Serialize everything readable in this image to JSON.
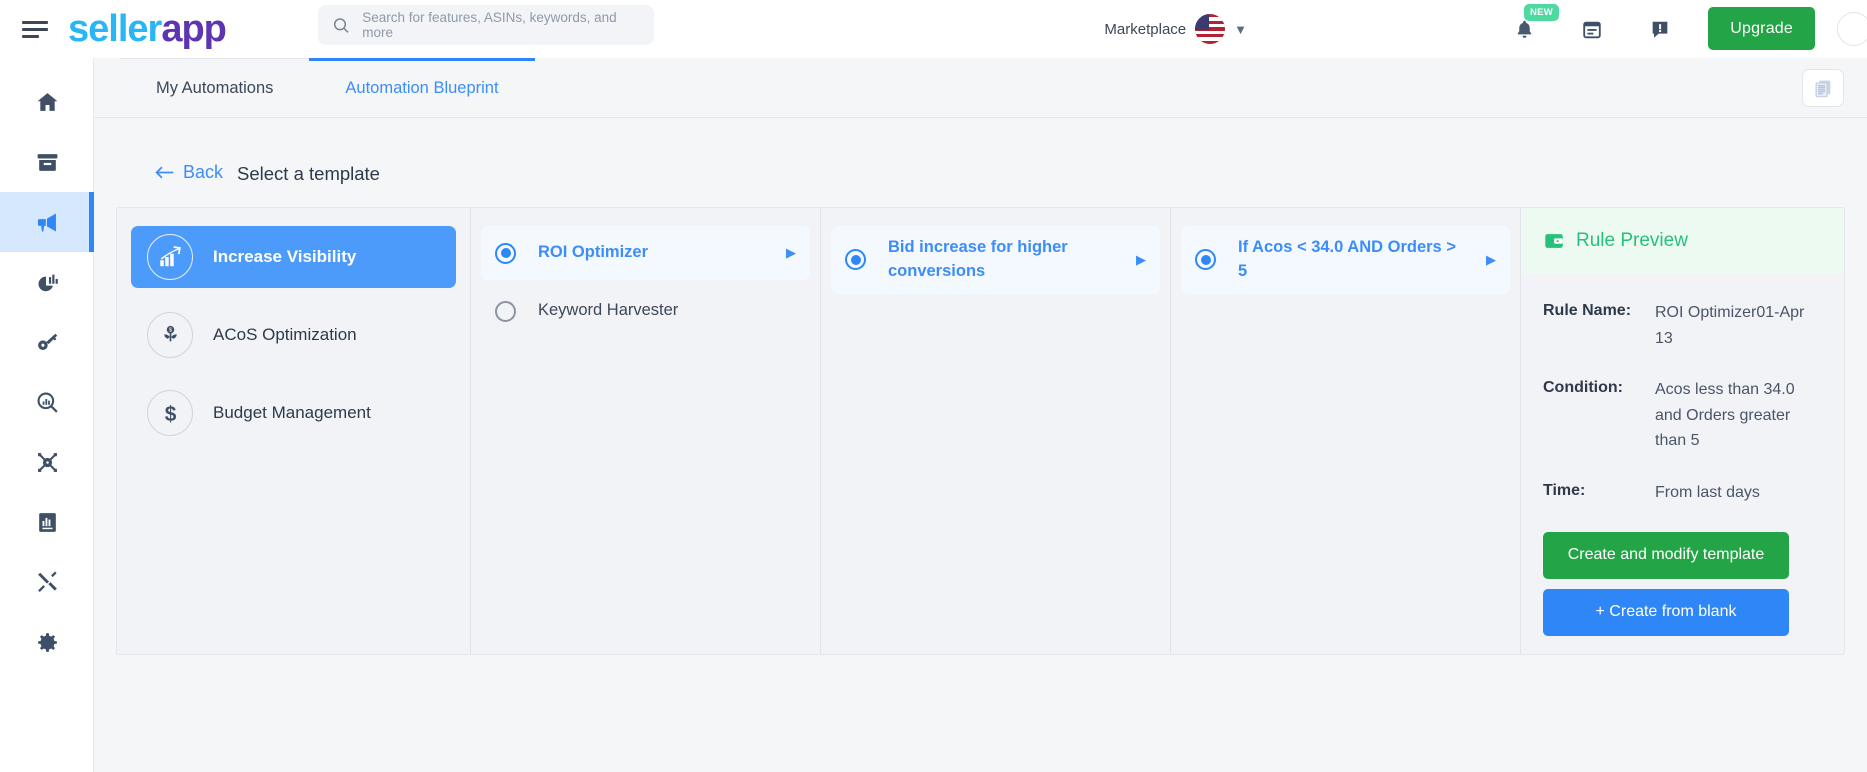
{
  "header": {
    "menu_icon": "hamburger-icon",
    "logo_part1": "seller",
    "logo_part2": "app",
    "search": {
      "icon": "search-icon",
      "placeholder": "Search for features, ASINs, keywords, and more",
      "value": ""
    },
    "marketplace_label": "Marketplace",
    "marketplace_flag": "us-flag-icon",
    "marketplace_chevron": "chevron-down-icon",
    "icons": [
      {
        "name": "notifications-bell-icon",
        "badge": "NEW"
      },
      {
        "name": "calendar-icon",
        "badge": ""
      },
      {
        "name": "announcement-icon",
        "badge": ""
      }
    ],
    "upgrade_label": "Upgrade"
  },
  "sidebar": {
    "items": [
      {
        "name": "sidebar-item-home",
        "icon": "home-icon",
        "active": false
      },
      {
        "name": "sidebar-item-products",
        "icon": "archive-box-icon",
        "active": false
      },
      {
        "name": "sidebar-item-advertising",
        "icon": "campaign-megaphone-icon",
        "active": true
      },
      {
        "name": "sidebar-item-analytics",
        "icon": "pie-chart-icon",
        "active": false
      },
      {
        "name": "sidebar-item-keywords",
        "icon": "key-icon",
        "active": false
      },
      {
        "name": "sidebar-item-research",
        "icon": "search-insights-icon",
        "active": false
      },
      {
        "name": "sidebar-item-network",
        "icon": "hub-network-icon",
        "active": false
      },
      {
        "name": "sidebar-item-reports",
        "icon": "report-document-icon",
        "active": false
      },
      {
        "name": "sidebar-item-tools",
        "icon": "tools-hammer-icon",
        "active": false
      },
      {
        "name": "sidebar-item-settings",
        "icon": "gear-icon",
        "active": false
      }
    ]
  },
  "tabs": [
    {
      "label": "My Automations",
      "active": false
    },
    {
      "label": "Automation Blueprint",
      "active": true
    }
  ],
  "copy_button_icon": "copy-documents-icon",
  "breadcrumb": {
    "back_arrow": "arrow-left-icon",
    "back_label": "Back",
    "title": "Select a template"
  },
  "columns": {
    "categories": [
      {
        "label": "Increase Visibility",
        "icon": "trending-up-chart-icon",
        "selected": true
      },
      {
        "label": "ACoS Optimization",
        "icon": "money-plant-icon",
        "selected": false
      },
      {
        "label": "Budget Management",
        "icon": "dollar-sign-icon",
        "selected": false
      }
    ],
    "templates": [
      {
        "label": "ROI Optimizer",
        "selected": true,
        "has_caret": true
      },
      {
        "label": "Keyword Harvester",
        "selected": false,
        "has_caret": false
      }
    ],
    "strategies": [
      {
        "label": "Bid increase for higher conversions",
        "selected": true,
        "has_caret": true
      }
    ],
    "conditions": [
      {
        "label": "If Acos < 34.0 AND Orders > 5",
        "selected": true,
        "has_caret": true
      }
    ]
  },
  "rule_preview": {
    "icon": "wallet-preview-icon",
    "title": "Rule Preview",
    "fields": [
      {
        "key": "Rule Name:",
        "value": "ROI Optimizer01-Apr 13"
      },
      {
        "key": "Condition:",
        "value": "Acos less than 34.0 and Orders greater than 5"
      },
      {
        "key": "Time:",
        "value": "From last days"
      }
    ],
    "primary_button": "Create and modify template",
    "secondary_button": "+ Create from blank"
  },
  "colors": {
    "accent_blue": "#2f86f6",
    "brand_green": "#22a447",
    "preview_green": "#26c17a",
    "sidebar_active_bg": "#d6e8fd",
    "page_bg": "#f4f6f8"
  }
}
